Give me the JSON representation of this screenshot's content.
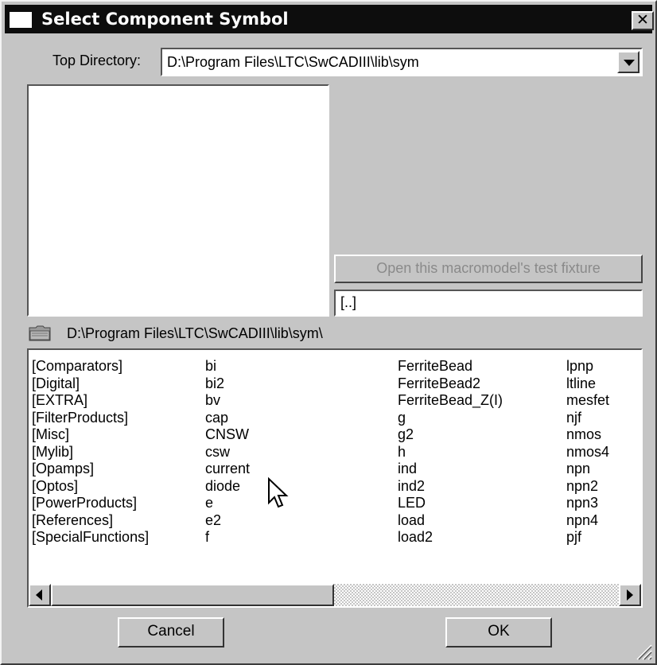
{
  "window": {
    "title": "Select Component Symbol",
    "close_glyph": "✕"
  },
  "top_directory": {
    "label": "Top Directory:",
    "value": "D:\\Program Files\\LTC\\SwCADIII\\lib\\sym"
  },
  "preview": {
    "test_fixture_label": "Open this macromodel's test fixture",
    "name_value": "[..]"
  },
  "path": {
    "icon": "folder-icon",
    "text": "D:\\Program Files\\LTC\\SwCADIII\\lib\\sym\\"
  },
  "list": {
    "columns": [
      [
        "[Comparators]",
        "[Digital]",
        "[EXTRA]",
        "[FilterProducts]",
        "[Misc]",
        "[Mylib]",
        "[Opamps]",
        "[Optos]",
        "[PowerProducts]",
        "[References]",
        "[SpecialFunctions]"
      ],
      [
        "bi",
        "bi2",
        "bv",
        "cap",
        "CNSW",
        "csw",
        "current",
        "diode",
        "e",
        "e2",
        "f"
      ],
      [
        "FerriteBead",
        "FerriteBead2",
        "FerriteBead_Z(I)",
        "g",
        "g2",
        "h",
        "ind",
        "ind2",
        "LED",
        "load",
        "load2"
      ],
      [
        "lpnp",
        "ltline",
        "mesfet",
        "njf",
        "nmos",
        "nmos4",
        "npn",
        "npn2",
        "npn3",
        "npn4",
        "pjf"
      ]
    ]
  },
  "buttons": {
    "cancel": "Cancel",
    "ok": "OK"
  },
  "colors": {
    "face": "#c5c5c5",
    "titlebar": "#0d0d0d",
    "disabled_text": "#8a8a8a"
  }
}
